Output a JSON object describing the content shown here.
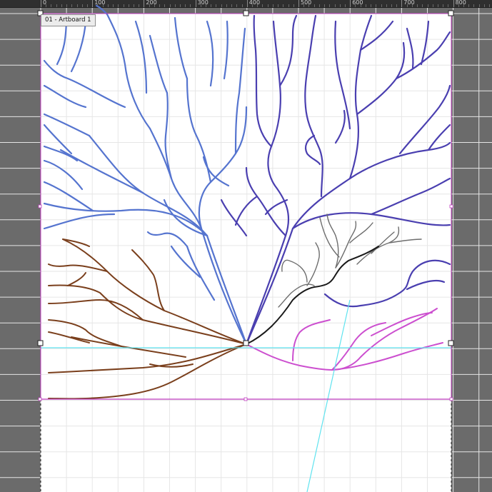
{
  "ruler": {
    "labels": [
      "0",
      "100",
      "200",
      "300",
      "400",
      "500",
      "600",
      "700",
      "800"
    ]
  },
  "artboard": {
    "tab_label": "01 - Artboard 1"
  },
  "colors": {
    "pasteboard": "#6b6b6b",
    "grid": "#e6e6e6",
    "selection": "#c03cc0",
    "guide": "#5fe3ef",
    "blue_branches": "#5574cf",
    "purple_branches": "#4a3fb0",
    "brown_branches": "#7a3f1c",
    "magenta_branches": "#cc4fcf",
    "black_branch": "#1a1a1a",
    "gray_branches": "#6d6d6d"
  },
  "icons": [
    "selection-handle-icon"
  ]
}
